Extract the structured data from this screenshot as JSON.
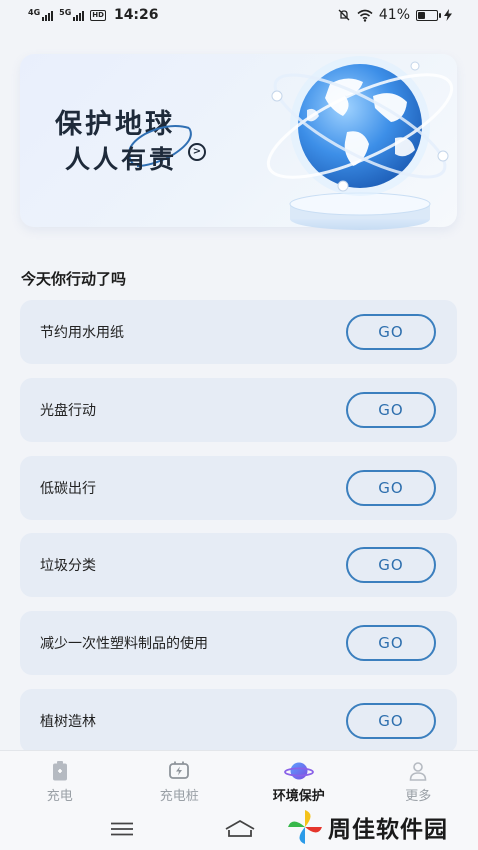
{
  "status_bar": {
    "network1": "4G",
    "network2": "5G",
    "hd": "HD",
    "time": "14:26",
    "battery_percent": "41%",
    "battery_level": 0.41
  },
  "banner": {
    "line1": "保护地球",
    "line2": "人人有责",
    "arrow_glyph": ">"
  },
  "section_title": "今天你行动了吗",
  "tasks": [
    {
      "label": "节约用水用纸",
      "button": "GO"
    },
    {
      "label": "光盘行动",
      "button": "GO"
    },
    {
      "label": "低碳出行",
      "button": "GO"
    },
    {
      "label": "垃圾分类",
      "button": "GO"
    },
    {
      "label": "减少一次性塑料制品的使用",
      "button": "GO"
    },
    {
      "label": "植树造林",
      "button": "GO"
    }
  ],
  "tabs": [
    {
      "label": "充电",
      "icon": "battery-charge-icon",
      "active": false
    },
    {
      "label": "充电桩",
      "icon": "charging-pile-icon",
      "active": false
    },
    {
      "label": "环境保护",
      "icon": "planet-icon",
      "active": true
    },
    {
      "label": "更多",
      "icon": "user-icon",
      "active": false
    }
  ],
  "watermark": {
    "text": "周佳软件园"
  },
  "colors": {
    "accent": "#3b7fbe",
    "task_bg": "#e6ecf5",
    "page_bg": "#f2f4f8",
    "tab_inactive": "#9aa0a6"
  }
}
